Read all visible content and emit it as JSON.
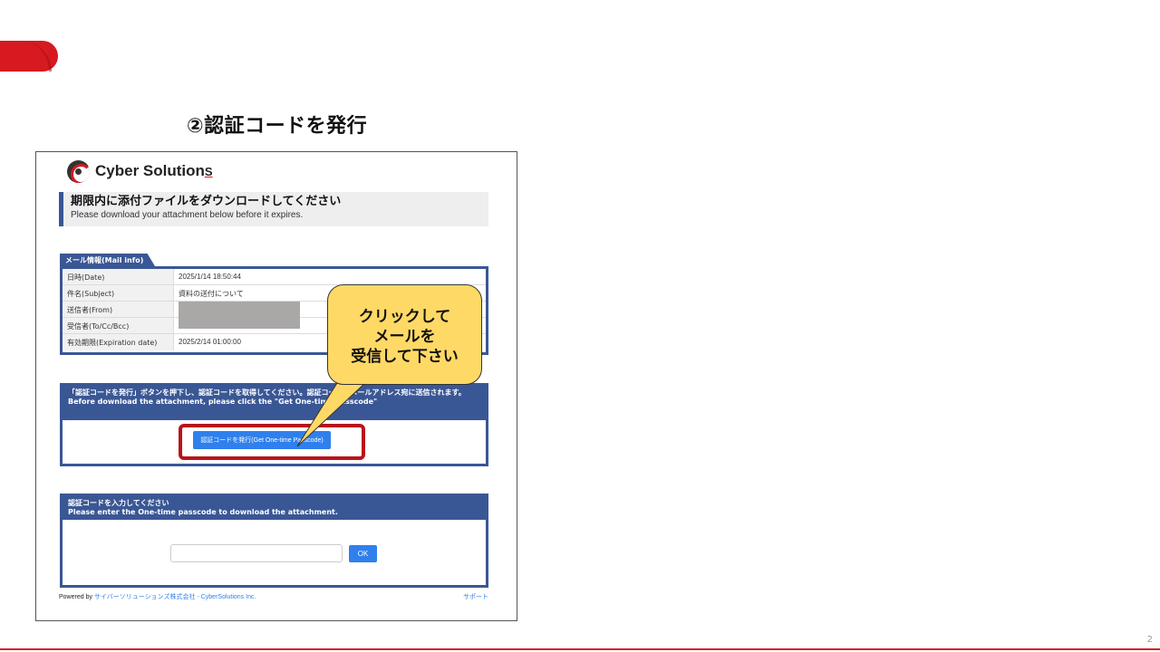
{
  "slide": {
    "title": "②認証コードを発行",
    "page_number": "2"
  },
  "colors": {
    "accent_red": "#d71920",
    "header_blue": "#3a5795",
    "button_blue": "#2f80ed",
    "callout_yellow": "#ffd966"
  },
  "screenshot": {
    "logo": {
      "text": "Cyber Solution",
      "suffix": "S",
      "icon": "cybersolutions-logo-icon"
    },
    "notice": {
      "jp": "期限内に添付ファイルをダウンロードしてください",
      "en": "Please download your attachment below before it expires."
    },
    "mail_info": {
      "tab_label": "メール情報(Mail info)",
      "rows": [
        {
          "key": "日時(Date)",
          "value": "2025/1/14 18:50:44"
        },
        {
          "key": "件名(Subject)",
          "value": "資料の送付について"
        },
        {
          "key": "送信者(From)",
          "value": ""
        },
        {
          "key": "受信者(To/Cc/Bcc)",
          "value": ""
        },
        {
          "key": "有効期限(Expiration date)",
          "value": "2025/2/14 01:00:00"
        }
      ]
    },
    "otp": {
      "instruction_jp": "「認証コードを発行」ボタンを押下し、認証コードを取得してください。認証コードはメールアドレス宛に送信されます。",
      "instruction_en": "Before download the attachment, please click the \"Get One-time Passcode\"",
      "button_label": "認証コードを発行(Get One-time Passcode)"
    },
    "code_entry": {
      "instruction_jp": "認証コードを入力してください",
      "instruction_en": "Please enter the One-time passcode to download the attachment.",
      "input_value": "",
      "ok_label": "OK"
    },
    "footer": {
      "powered_by": "Powered by",
      "company": "サイバーソリューションズ株式会社 - CyberSolutions Inc.",
      "support": "サポート"
    }
  },
  "callout": {
    "text": "クリックして\nメールを\n受信して下さい"
  }
}
